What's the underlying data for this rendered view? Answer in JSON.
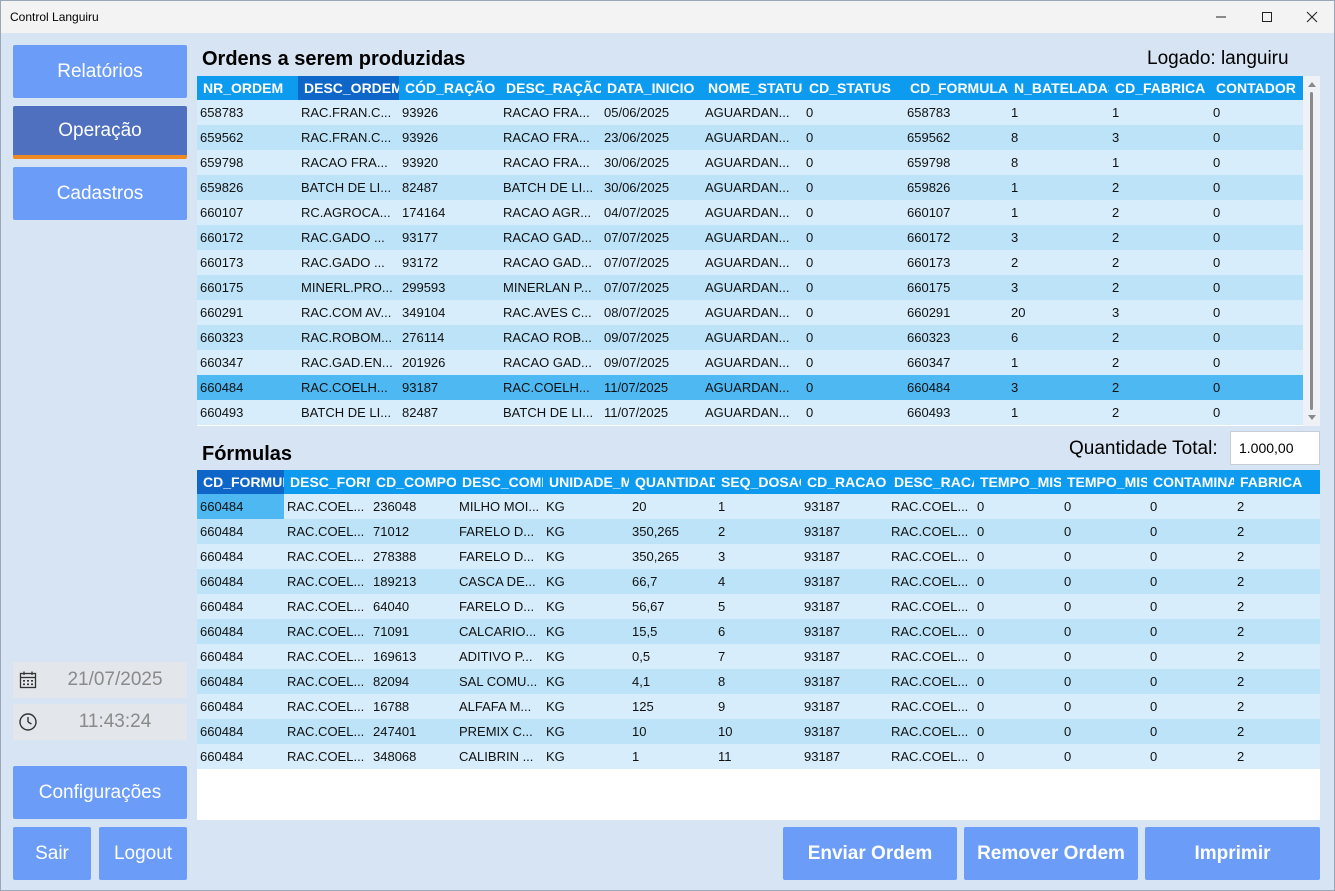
{
  "window": {
    "title": "Control Languiru"
  },
  "sidebar": {
    "items": [
      {
        "label": "Relatórios"
      },
      {
        "label": "Operação"
      },
      {
        "label": "Cadastros"
      }
    ],
    "date": "21/07/2025",
    "time": "11:43:24",
    "config_label": "Configurações",
    "exit_label": "Sair",
    "logout_label": "Logout"
  },
  "header": {
    "logged": "Logado: languiru"
  },
  "orders": {
    "title": "Ordens a serem produzidas",
    "columns": [
      "NR_ORDEM",
      "DESC_ORDEM",
      "CÓD_RAÇÃO",
      "DESC_RAÇÃO",
      "DATA_INICIO",
      "NOME_STATUS",
      "CD_STATUS",
      "CD_FORMULA",
      "N_BATELADAS",
      "CD_FABRICA",
      "CONTADOR"
    ],
    "rows": [
      [
        "658783",
        "RAC.FRAN.C...",
        "93926",
        "RACAO FRA...",
        "05/06/2025",
        "AGUARDAN...",
        "0",
        "658783",
        "1",
        "1",
        "0"
      ],
      [
        "659562",
        "RAC.FRAN.C...",
        "93926",
        "RACAO FRA...",
        "23/06/2025",
        "AGUARDAN...",
        "0",
        "659562",
        "8",
        "3",
        "0"
      ],
      [
        "659798",
        "RACAO FRA...",
        "93920",
        "RACAO FRA...",
        "30/06/2025",
        "AGUARDAN...",
        "0",
        "659798",
        "8",
        "1",
        "0"
      ],
      [
        "659826",
        "BATCH DE LI...",
        "82487",
        "BATCH DE LI...",
        "30/06/2025",
        "AGUARDAN...",
        "0",
        "659826",
        "1",
        "2",
        "0"
      ],
      [
        "660107",
        "RC.AGROCA...",
        "174164",
        "RACAO AGR...",
        "04/07/2025",
        "AGUARDAN...",
        "0",
        "660107",
        "1",
        "2",
        "0"
      ],
      [
        "660172",
        "RAC.GADO ...",
        "93177",
        "RACAO GAD...",
        "07/07/2025",
        "AGUARDAN...",
        "0",
        "660172",
        "3",
        "2",
        "0"
      ],
      [
        "660173",
        "RAC.GADO ...",
        "93172",
        "RACAO GAD...",
        "07/07/2025",
        "AGUARDAN...",
        "0",
        "660173",
        "2",
        "2",
        "0"
      ],
      [
        "660175",
        "MINERL.PRO...",
        "299593",
        "MINERLAN P...",
        "07/07/2025",
        "AGUARDAN...",
        "0",
        "660175",
        "3",
        "2",
        "0"
      ],
      [
        "660291",
        "RAC.COM AV...",
        "349104",
        "RAC.AVES C...",
        "08/07/2025",
        "AGUARDAN...",
        "0",
        "660291",
        "20",
        "3",
        "0"
      ],
      [
        "660323",
        "RAC.ROBOM...",
        "276114",
        "RACAO ROB...",
        "09/07/2025",
        "AGUARDAN...",
        "0",
        "660323",
        "6",
        "2",
        "0"
      ],
      [
        "660347",
        "RAC.GAD.EN...",
        "201926",
        "RACAO GAD...",
        "09/07/2025",
        "AGUARDAN...",
        "0",
        "660347",
        "1",
        "2",
        "0"
      ],
      [
        "660484",
        "RAC.COELH...",
        "93187",
        "RAC.COELH...",
        "11/07/2025",
        "AGUARDAN...",
        "0",
        "660484",
        "3",
        "2",
        "0"
      ],
      [
        "660493",
        "BATCH DE LI...",
        "82487",
        "BATCH DE LI...",
        "11/07/2025",
        "AGUARDAN...",
        "0",
        "660493",
        "1",
        "2",
        "0"
      ]
    ]
  },
  "formulas": {
    "title": "Fórmulas",
    "qty_label": "Quantidade Total:",
    "qty_value": "1.000,00",
    "columns": [
      "CD_FORMULA",
      "DESC_FORM",
      "CD_COMPONENTE",
      "DESC_COMP",
      "UNIDADE_MEDIDA",
      "QUANTIDADE",
      "SEQ_DOSAGEM",
      "CD_RACAO",
      "DESC_RACAO",
      "TEMPO_MISTURA",
      "TEMPO_MIS",
      "CONTAMINA",
      "FABRICA"
    ],
    "rows": [
      [
        "660484",
        "RAC.COEL...",
        "236048",
        "MILHO MOI...",
        "KG",
        "20",
        "1",
        "93187",
        "RAC.COEL...",
        "0",
        "0",
        "0",
        "2"
      ],
      [
        "660484",
        "RAC.COEL...",
        "71012",
        "FARELO D...",
        "KG",
        "350,265",
        "2",
        "93187",
        "RAC.COEL...",
        "0",
        "0",
        "0",
        "2"
      ],
      [
        "660484",
        "RAC.COEL...",
        "278388",
        "FARELO D...",
        "KG",
        "350,265",
        "3",
        "93187",
        "RAC.COEL...",
        "0",
        "0",
        "0",
        "2"
      ],
      [
        "660484",
        "RAC.COEL...",
        "189213",
        "CASCA DE...",
        "KG",
        "66,7",
        "4",
        "93187",
        "RAC.COEL...",
        "0",
        "0",
        "0",
        "2"
      ],
      [
        "660484",
        "RAC.COEL...",
        "64040",
        "FARELO D...",
        "KG",
        "56,67",
        "5",
        "93187",
        "RAC.COEL...",
        "0",
        "0",
        "0",
        "2"
      ],
      [
        "660484",
        "RAC.COEL...",
        "71091",
        "CALCARIO...",
        "KG",
        "15,5",
        "6",
        "93187",
        "RAC.COEL...",
        "0",
        "0",
        "0",
        "2"
      ],
      [
        "660484",
        "RAC.COEL...",
        "169613",
        "ADITIVO P...",
        "KG",
        "0,5",
        "7",
        "93187",
        "RAC.COEL...",
        "0",
        "0",
        "0",
        "2"
      ],
      [
        "660484",
        "RAC.COEL...",
        "82094",
        "SAL COMU...",
        "KG",
        "4,1",
        "8",
        "93187",
        "RAC.COEL...",
        "0",
        "0",
        "0",
        "2"
      ],
      [
        "660484",
        "RAC.COEL...",
        "16788",
        "ALFAFA M...",
        "KG",
        "125",
        "9",
        "93187",
        "RAC.COEL...",
        "0",
        "0",
        "0",
        "2"
      ],
      [
        "660484",
        "RAC.COEL...",
        "247401",
        "PREMIX C...",
        "KG",
        "10",
        "10",
        "93187",
        "RAC.COEL...",
        "0",
        "0",
        "0",
        "2"
      ],
      [
        "660484",
        "RAC.COEL...",
        "348068",
        "CALIBRIN ...",
        "KG",
        "1",
        "11",
        "93187",
        "RAC.COEL...",
        "0",
        "0",
        "0",
        "2"
      ]
    ]
  },
  "actions": {
    "send": "Enviar Ordem",
    "remove": "Remover Ordem",
    "print": "Imprimir"
  },
  "colors": {
    "accent": "#6b9cf7",
    "active": "#4f6fbf",
    "header": "#0d9bf0",
    "selected_row": "#4db8f2",
    "underline": "#f08a24"
  }
}
